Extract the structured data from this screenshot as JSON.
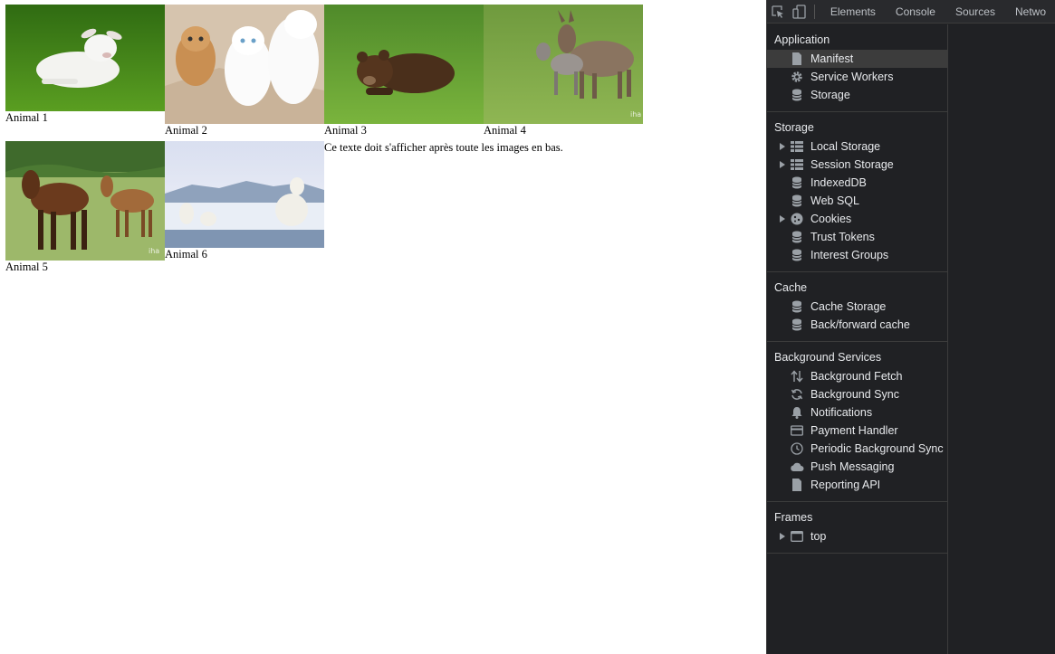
{
  "page": {
    "figures": [
      {
        "caption": "Animal 1"
      },
      {
        "caption": "Animal 2"
      },
      {
        "caption": "Animal 3"
      },
      {
        "caption": "Animal 4"
      },
      {
        "caption": "Animal 5"
      },
      {
        "caption": "Animal 6"
      }
    ],
    "after_text": "Ce texte doit s'afficher après toute les images en bas."
  },
  "devtools": {
    "tabs": [
      "Elements",
      "Console",
      "Sources",
      "Netwo"
    ],
    "sections": [
      {
        "title": "Application",
        "items": [
          {
            "label": "Manifest",
            "icon": "document-icon",
            "selected": true,
            "expandable": false
          },
          {
            "label": "Service Workers",
            "icon": "gear-icon",
            "selected": false,
            "expandable": false
          },
          {
            "label": "Storage",
            "icon": "database-icon",
            "selected": false,
            "expandable": false
          }
        ]
      },
      {
        "title": "Storage",
        "items": [
          {
            "label": "Local Storage",
            "icon": "grid-icon",
            "selected": false,
            "expandable": true
          },
          {
            "label": "Session Storage",
            "icon": "grid-icon",
            "selected": false,
            "expandable": true
          },
          {
            "label": "IndexedDB",
            "icon": "database-icon",
            "selected": false,
            "expandable": false
          },
          {
            "label": "Web SQL",
            "icon": "database-icon",
            "selected": false,
            "expandable": false
          },
          {
            "label": "Cookies",
            "icon": "cookie-icon",
            "selected": false,
            "expandable": true
          },
          {
            "label": "Trust Tokens",
            "icon": "database-icon",
            "selected": false,
            "expandable": false
          },
          {
            "label": "Interest Groups",
            "icon": "database-icon",
            "selected": false,
            "expandable": false
          }
        ]
      },
      {
        "title": "Cache",
        "items": [
          {
            "label": "Cache Storage",
            "icon": "database-icon",
            "selected": false,
            "expandable": false
          },
          {
            "label": "Back/forward cache",
            "icon": "database-icon",
            "selected": false,
            "expandable": false
          }
        ]
      },
      {
        "title": "Background Services",
        "items": [
          {
            "label": "Background Fetch",
            "icon": "up-down-arrows-icon",
            "selected": false,
            "expandable": false
          },
          {
            "label": "Background Sync",
            "icon": "sync-icon",
            "selected": false,
            "expandable": false
          },
          {
            "label": "Notifications",
            "icon": "bell-icon",
            "selected": false,
            "expandable": false
          },
          {
            "label": "Payment Handler",
            "icon": "credit-card-icon",
            "selected": false,
            "expandable": false
          },
          {
            "label": "Periodic Background Sync",
            "icon": "clock-icon",
            "selected": false,
            "expandable": false
          },
          {
            "label": "Push Messaging",
            "icon": "cloud-icon",
            "selected": false,
            "expandable": false
          },
          {
            "label": "Reporting API",
            "icon": "document-icon",
            "selected": false,
            "expandable": false
          }
        ]
      },
      {
        "title": "Frames",
        "items": [
          {
            "label": "top",
            "icon": "frame-icon",
            "selected": false,
            "expandable": true
          }
        ]
      }
    ],
    "colors": {
      "background": "#202124",
      "toolbar": "#292a2d",
      "selected": "#3c3c3c",
      "text": "#e8eaed",
      "icon": "#9aa0a6"
    }
  }
}
